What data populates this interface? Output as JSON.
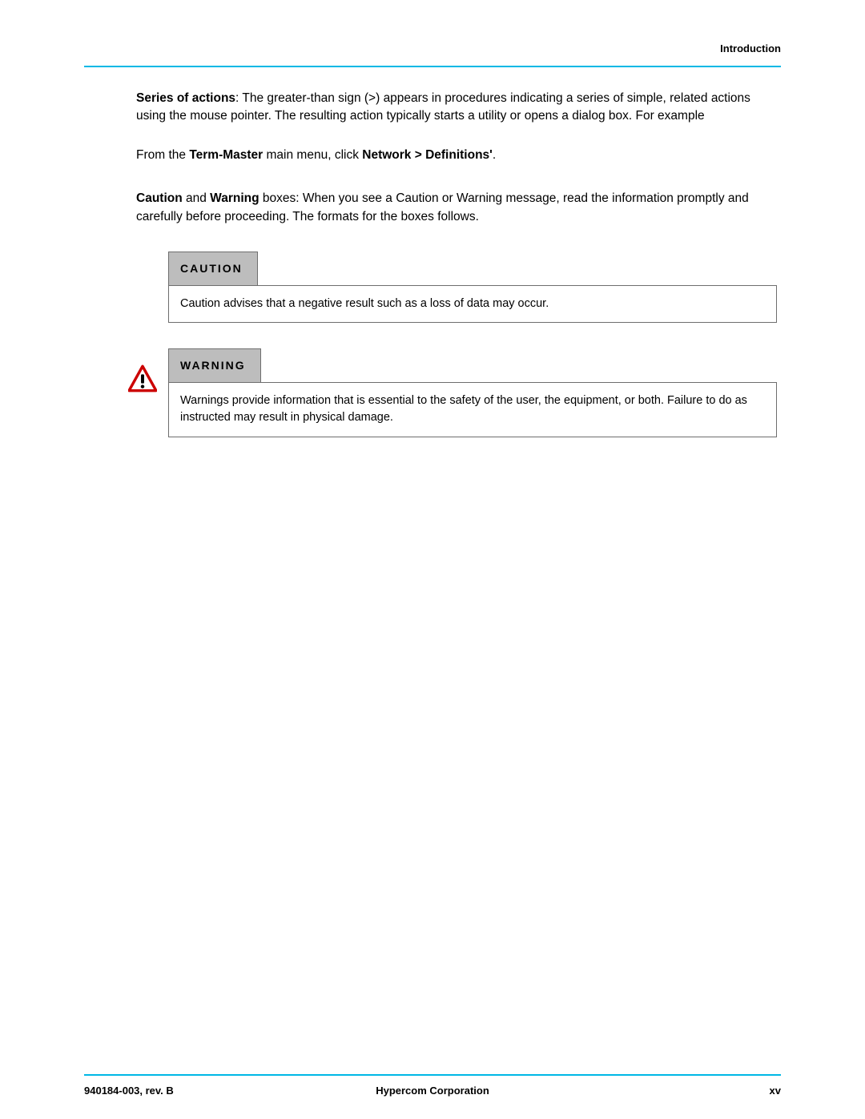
{
  "header": {
    "section": "Introduction"
  },
  "body": {
    "series_label": "Series of actions",
    "series_text": ": The greater-than sign (>) appears in procedures indicating a series of simple, related actions using the mouse pointer. The resulting action typically starts a utility or opens a dialog box. For example",
    "example_prefix": "From the ",
    "example_bold1": "Term-Master",
    "example_mid": " main menu, click ",
    "example_bold2": "Network > Definitions'",
    "example_suffix": ".",
    "caution_label": "Caution",
    "caution_and": " and ",
    "warning_label": "Warning",
    "caution_text": " boxes: When you see a Caution or Warning message, read the information promptly and carefully before proceeding. The formats for the boxes follows.",
    "box_caution_title": "CAUTION",
    "box_caution_body": "Caution advises that a negative result such as a loss of data may occur.",
    "box_warning_title": "WARNING",
    "box_warning_body": "Warnings provide information that is essential to the safety of the user, the equipment, or both. Failure to do as instructed may result in physical damage."
  },
  "footer": {
    "doc_id": "940184-003, rev. B",
    "company": "Hypercom Corporation",
    "page": "xv"
  }
}
